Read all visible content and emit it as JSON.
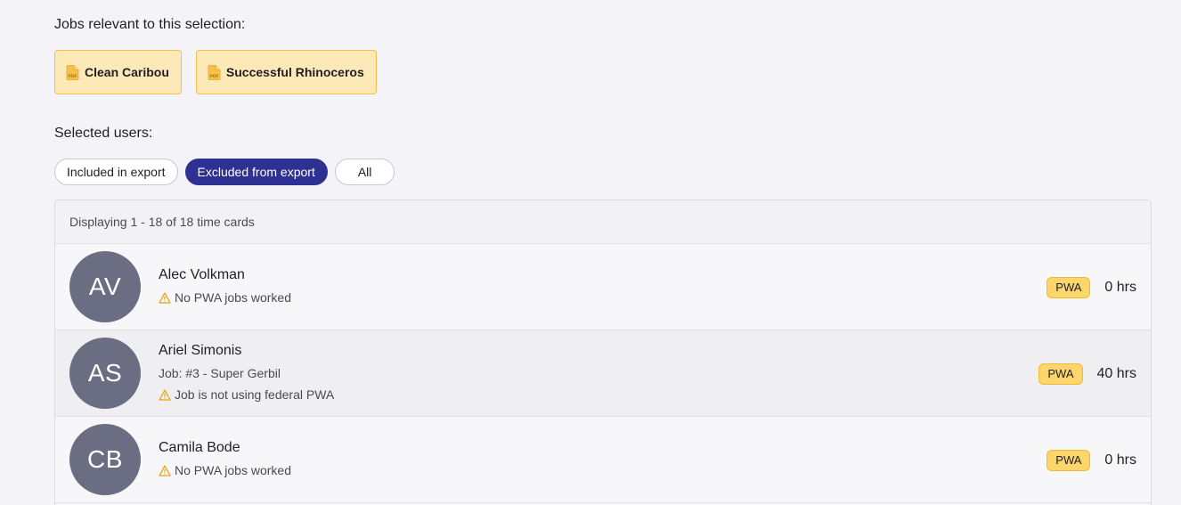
{
  "jobs_section": {
    "label": "Jobs relevant to this selection:",
    "jobs": [
      {
        "name": "Clean Caribou",
        "icon": "pdf-file-icon"
      },
      {
        "name": "Successful Rhinoceros",
        "icon": "pdf-file-icon"
      }
    ]
  },
  "users_section": {
    "label": "Selected users:",
    "filters": [
      {
        "label": "Included in export",
        "active": false
      },
      {
        "label": "Excluded from export",
        "active": true
      },
      {
        "label": "All",
        "active": false
      }
    ]
  },
  "time_cards": {
    "header": "Displaying 1 - 18 of 18 time cards",
    "rows": [
      {
        "initials": "AV",
        "name": "Alec Volkman",
        "job": null,
        "warning": "No PWA jobs worked",
        "badge": "PWA",
        "hours": "0 hrs"
      },
      {
        "initials": "AS",
        "name": "Ariel Simonis",
        "job": "Job: #3 - Super Gerbil",
        "warning": "Job is not using federal PWA",
        "badge": "PWA",
        "hours": "40 hrs"
      },
      {
        "initials": "CB",
        "name": "Camila Bode",
        "job": null,
        "warning": "No PWA jobs worked",
        "badge": "PWA",
        "hours": "0 hrs"
      }
    ]
  },
  "colors": {
    "accent": "#2e3192",
    "job_chip_bg": "#fde8b8",
    "pwa_badge_bg": "#fcd56b",
    "avatar_bg": "#6b6e82",
    "warning": "#e8a317"
  }
}
